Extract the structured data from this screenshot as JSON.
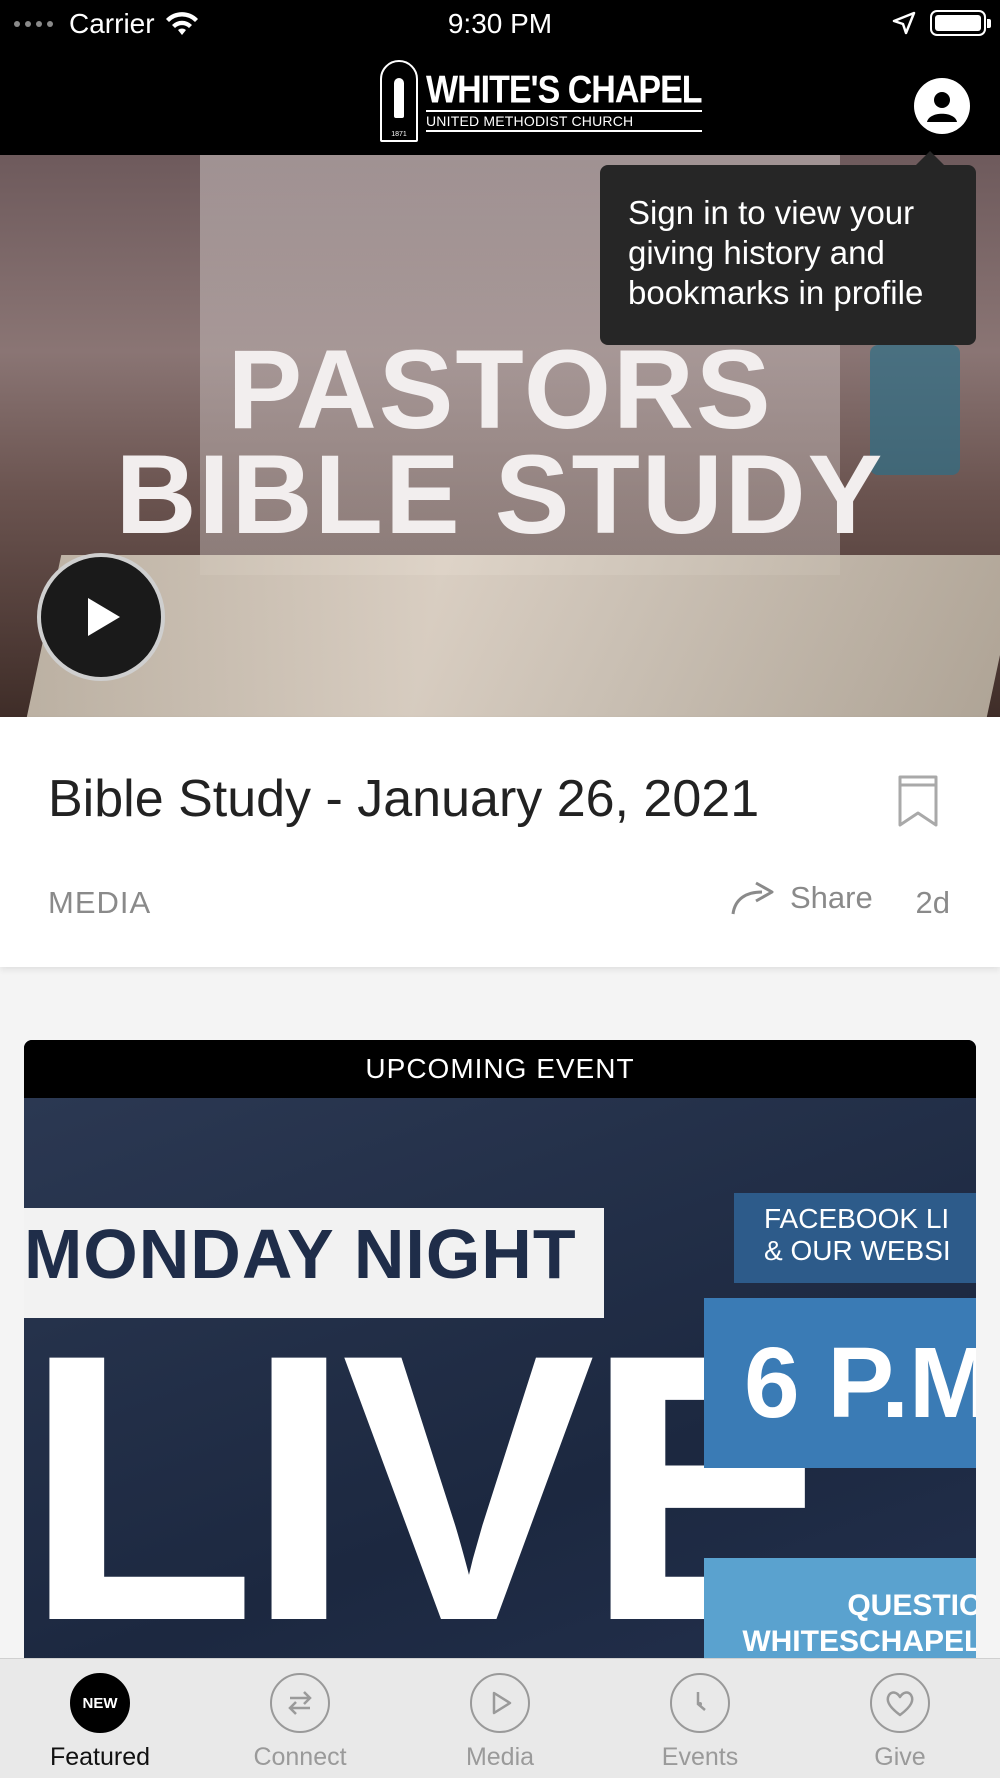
{
  "status_bar": {
    "carrier": "Carrier",
    "time": "9:30 PM"
  },
  "header": {
    "logo_line1": "WHITE'S CHAPEL",
    "logo_line2": "UNITED METHODIST CHURCH",
    "logo_year": "1871"
  },
  "tooltip": {
    "text": "Sign in to view your giving history and bookmarks in profile"
  },
  "hero": {
    "title_line1": "PASTORS",
    "title_line2": "BIBLE STUDY"
  },
  "card": {
    "title": "Bible Study - January 26, 2021",
    "category": "MEDIA",
    "share_label": "Share",
    "age": "2d"
  },
  "event": {
    "banner": "UPCOMING EVENT",
    "line1": "MONDAY NIGHT",
    "line2": "LIVE",
    "fb_text_1": "FACEBOOK LI",
    "fb_text_2": "& OUR WEBSI",
    "time_text": "6 P.M",
    "question_1": "QUESTION",
    "question_2": "WHITESCHAPELU"
  },
  "tabs": [
    {
      "label": "Featured",
      "badge": "NEW",
      "icon": "new-badge-icon"
    },
    {
      "label": "Connect",
      "icon": "connect-arrows-icon"
    },
    {
      "label": "Media",
      "icon": "play-icon"
    },
    {
      "label": "Events",
      "icon": "clock-icon"
    },
    {
      "label": "Give",
      "icon": "heart-icon"
    }
  ]
}
